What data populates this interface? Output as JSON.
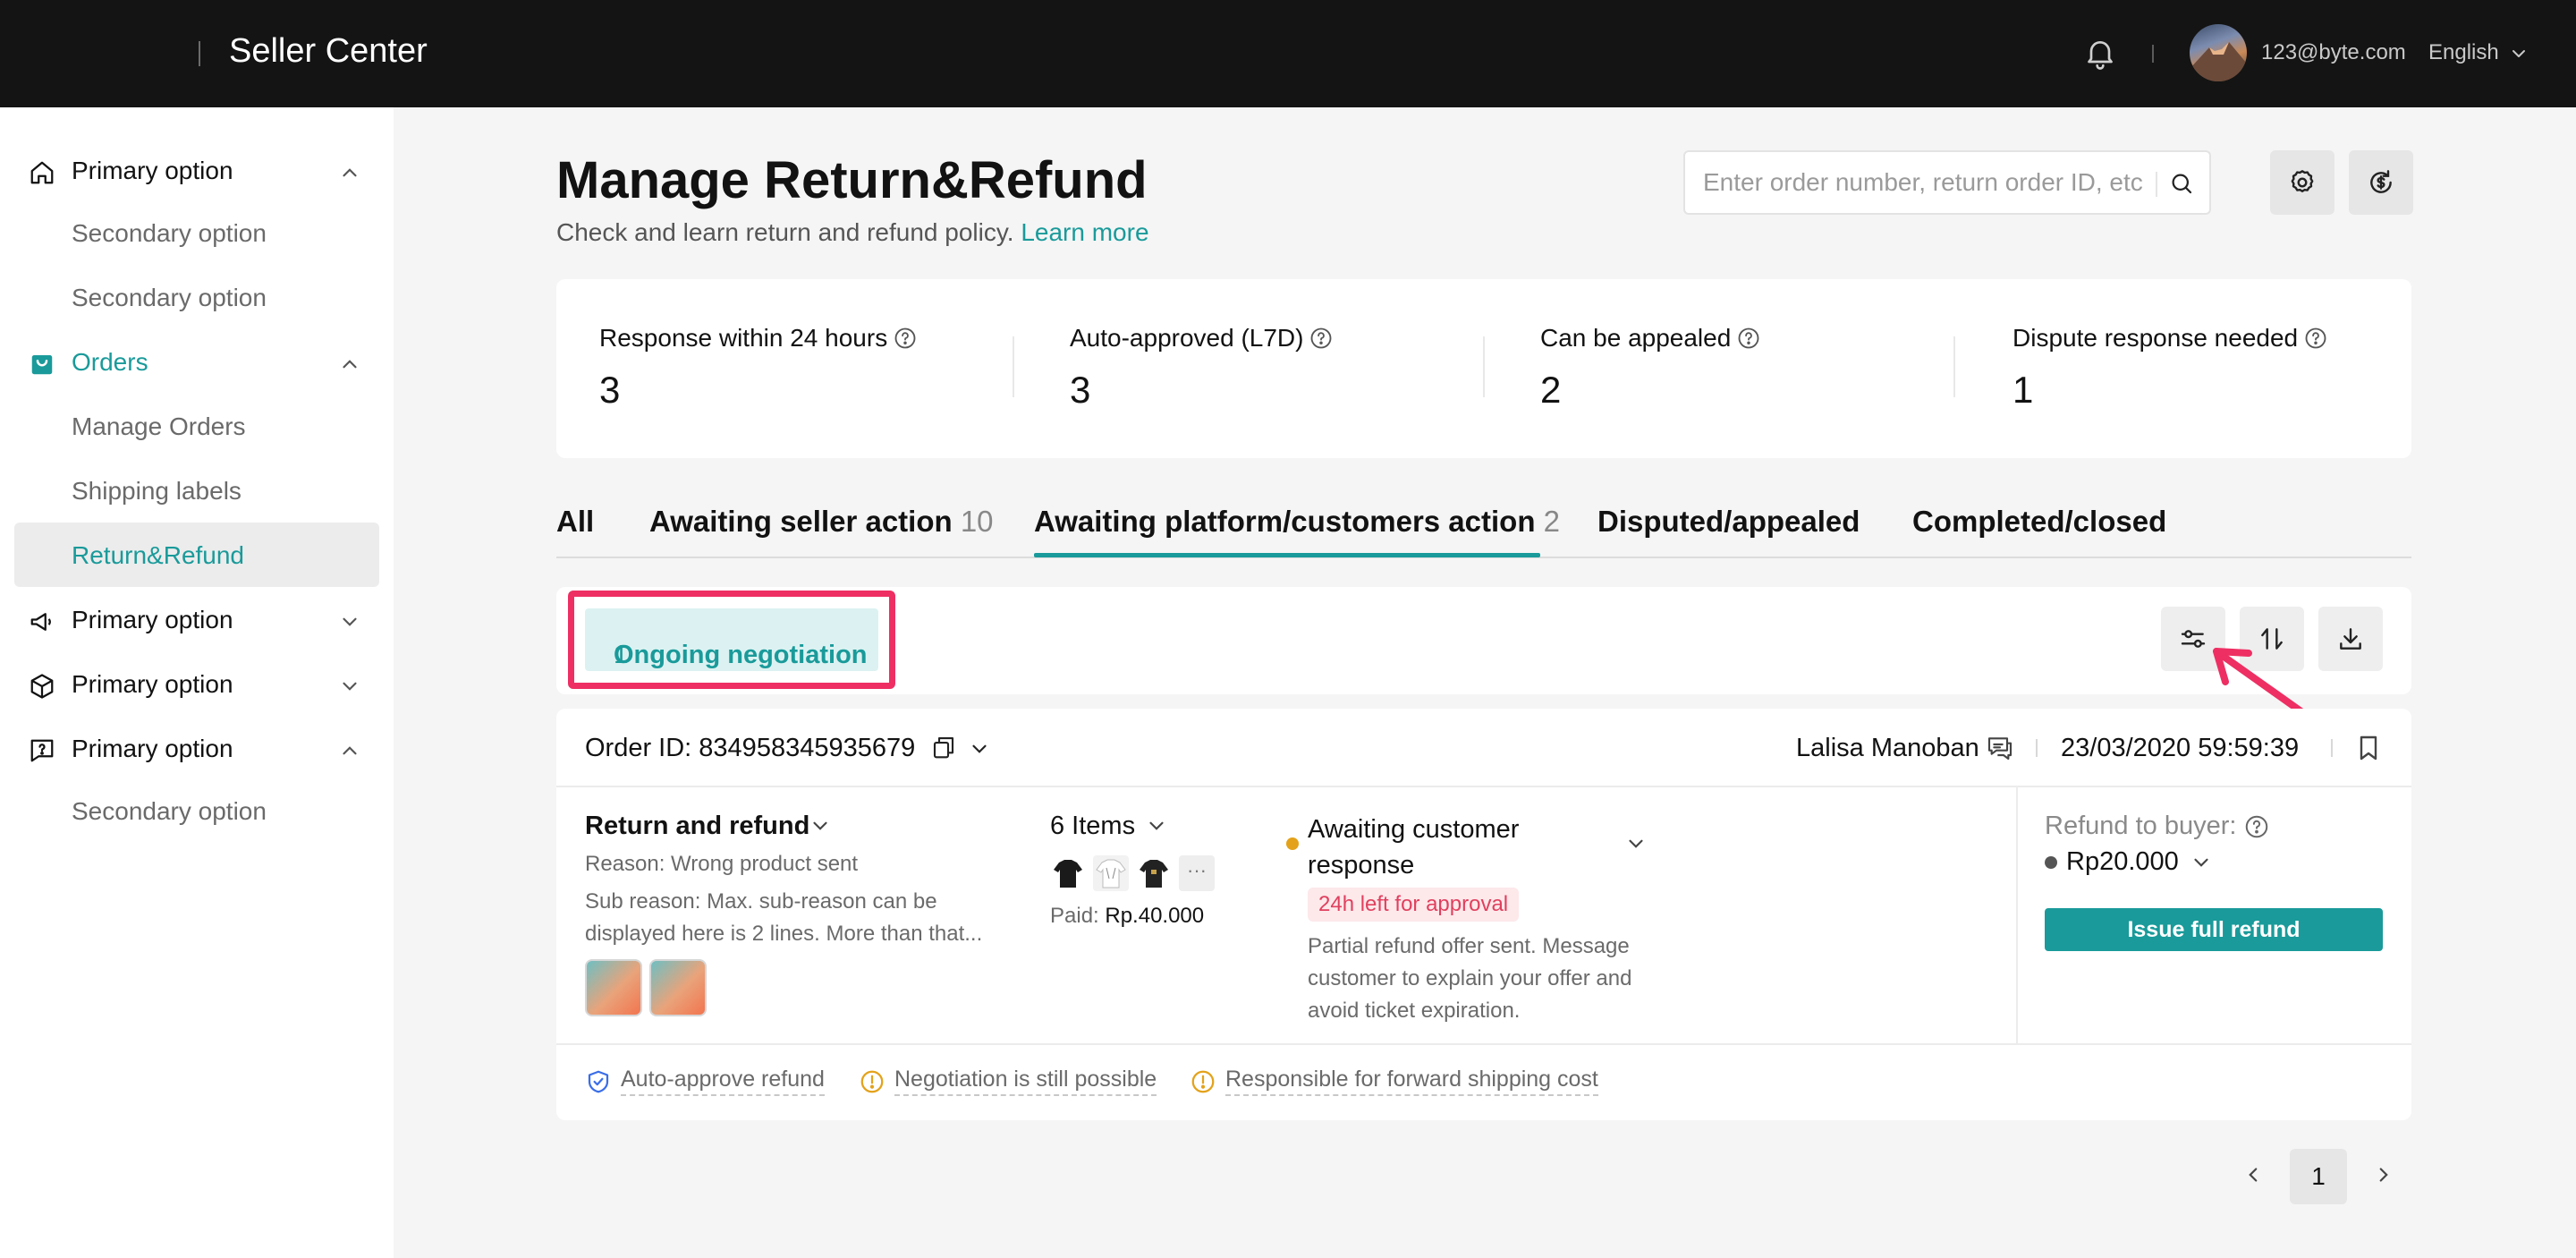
{
  "topbar": {
    "title": "Seller Center",
    "user_email": "123@byte.com",
    "language": "English"
  },
  "sidebar": {
    "items": [
      {
        "label": "Primary option",
        "icon": "home-icon",
        "expanded": true
      },
      {
        "label": "Secondary option"
      },
      {
        "label": "Secondary option"
      },
      {
        "label": "Orders",
        "icon": "shopping-bag-icon",
        "expanded": true,
        "active": true
      },
      {
        "label": "Manage Orders"
      },
      {
        "label": "Shipping labels"
      },
      {
        "label": "Return&Refund",
        "selected": true
      },
      {
        "label": "Primary option",
        "icon": "megaphone-icon",
        "expanded": false
      },
      {
        "label": "Primary option",
        "icon": "box-icon",
        "expanded": false
      },
      {
        "label": "Primary option",
        "icon": "help-chat-icon",
        "expanded": true
      },
      {
        "label": "Secondary option"
      }
    ]
  },
  "header": {
    "title": "Manage Return&Refund",
    "subtitle": "Check and learn return and refund policy.",
    "learn_more": "Learn more",
    "search_placeholder": "Enter order number, return order ID, etc"
  },
  "stats": [
    {
      "label": "Response within 24 hours",
      "value": "3"
    },
    {
      "label": "Auto-approved (L7D)",
      "value": "3"
    },
    {
      "label": "Can be appealed",
      "value": "2"
    },
    {
      "label": "Dispute response needed",
      "value": "1"
    }
  ],
  "tabs": [
    {
      "label": "All",
      "count": ""
    },
    {
      "label": "Awaiting seller action",
      "count": "10"
    },
    {
      "label": "Awaiting platform/customers action",
      "count": "2",
      "active": true
    },
    {
      "label": "Disputed/appealed",
      "count": ""
    },
    {
      "label": "Completed/closed",
      "count": ""
    }
  ],
  "filter": {
    "chip_label": "Ongoing negotiation",
    "chip_count": "1"
  },
  "order": {
    "order_id_label": "Order ID: 834958345935679",
    "buyer": "Lalisa Manoban",
    "datetime": "23/03/2020 59:59:39",
    "type": "Return and refund",
    "reason": "Reason: Wrong product sent",
    "sub_reason": "Sub reason: Max. sub-reason can be displayed here is 2 lines. More than that...",
    "items_label": "6 Items",
    "more_items": "···",
    "paid_label": "Paid:",
    "paid_amount": "Rp.40.000",
    "status": "Awaiting customer response",
    "time_left": "24h left for approval",
    "status_desc": "Partial refund offer sent. Message customer to explain your offer and avoid ticket expiration.",
    "refund_label": "Refund to buyer:",
    "refund_amount": "Rp20.000",
    "issue_button": "Issue full refund",
    "tags": [
      {
        "label": "Auto-approve refund",
        "icon": "shield-check-icon"
      },
      {
        "label": "Negotiation is still possible",
        "icon": "warning-circle-icon"
      },
      {
        "label": "Responsible for forward shipping cost",
        "icon": "warning-circle-icon"
      }
    ]
  },
  "pagination": {
    "current": "1"
  },
  "colors": {
    "accent": "#1a9a9a",
    "highlight": "#ee2f63",
    "topbar": "#141414",
    "status_dot": "#e3a21a"
  }
}
